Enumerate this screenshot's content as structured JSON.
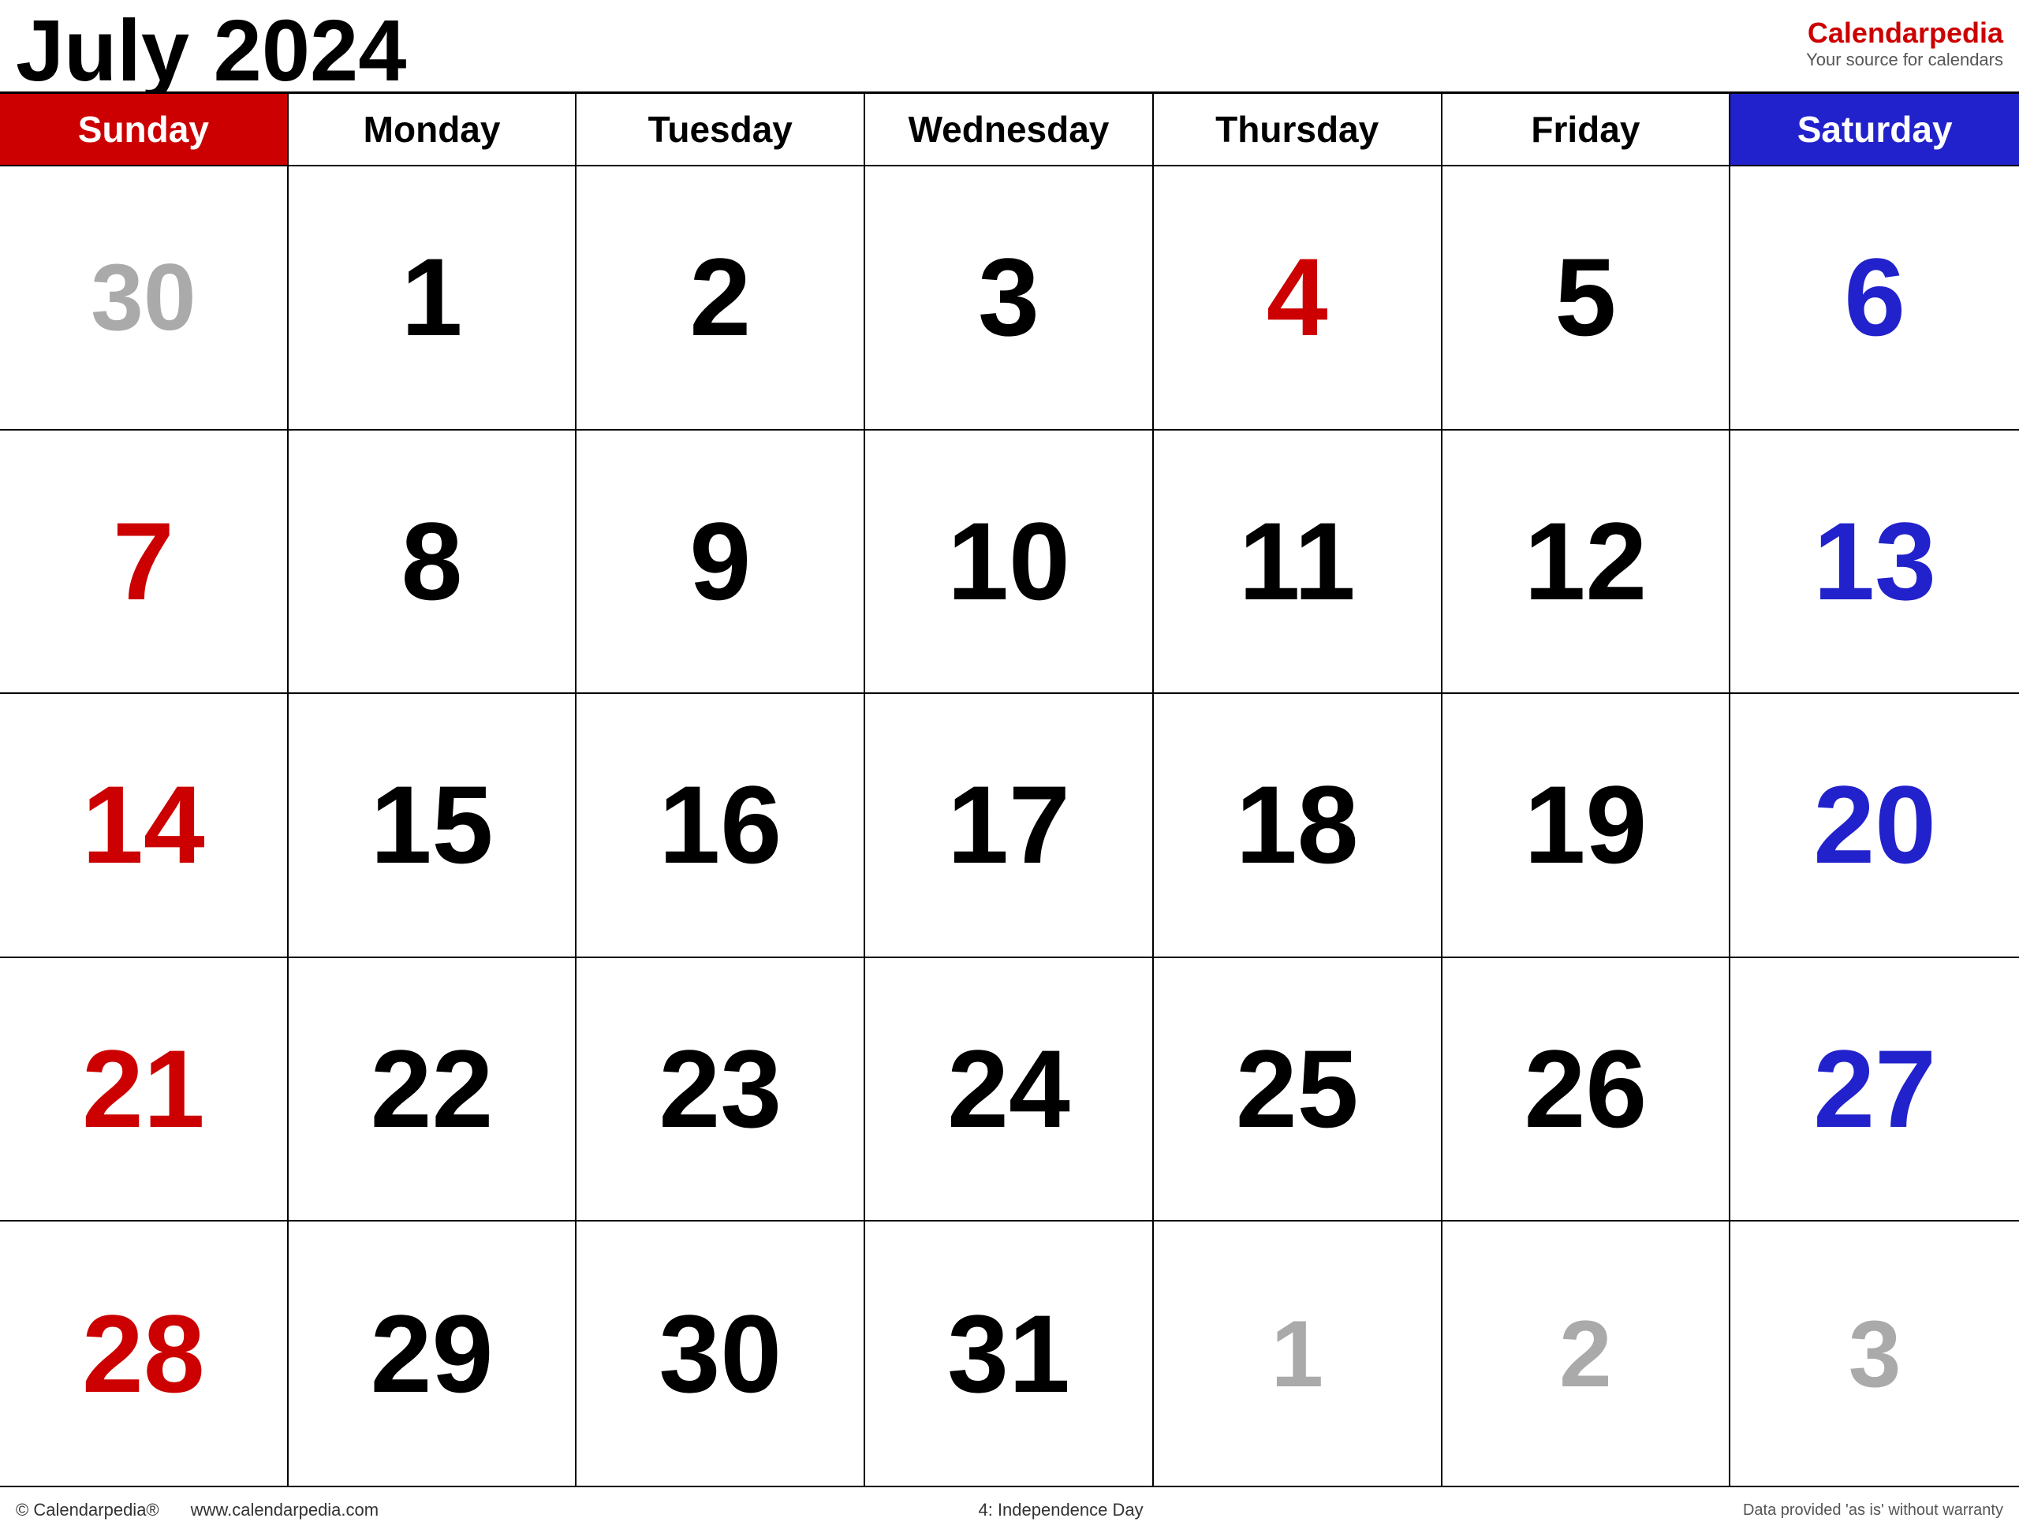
{
  "header": {
    "title": "July 2024",
    "brand": {
      "name": "Calendar",
      "name_accent": "pedia",
      "tagline": "Your source for calendars"
    }
  },
  "colors": {
    "sunday": "#cc0000",
    "saturday": "#2222cc",
    "holiday": "#cc0000",
    "other_month": "#aaaaaa",
    "header_sunday_bg": "#cc0000",
    "header_saturday_bg": "#2222cc"
  },
  "days_of_week": [
    {
      "label": "Sunday",
      "type": "sunday"
    },
    {
      "label": "Monday",
      "type": "weekday"
    },
    {
      "label": "Tuesday",
      "type": "weekday"
    },
    {
      "label": "Wednesday",
      "type": "weekday"
    },
    {
      "label": "Thursday",
      "type": "weekday"
    },
    {
      "label": "Friday",
      "type": "weekday"
    },
    {
      "label": "Saturday",
      "type": "saturday"
    }
  ],
  "weeks": [
    [
      {
        "day": "30",
        "type": "other-month"
      },
      {
        "day": "1",
        "type": "weekday"
      },
      {
        "day": "2",
        "type": "weekday"
      },
      {
        "day": "3",
        "type": "weekday"
      },
      {
        "day": "4",
        "type": "holiday"
      },
      {
        "day": "5",
        "type": "weekday"
      },
      {
        "day": "6",
        "type": "saturday"
      }
    ],
    [
      {
        "day": "7",
        "type": "sunday"
      },
      {
        "day": "8",
        "type": "weekday"
      },
      {
        "day": "9",
        "type": "weekday"
      },
      {
        "day": "10",
        "type": "weekday"
      },
      {
        "day": "11",
        "type": "weekday"
      },
      {
        "day": "12",
        "type": "weekday"
      },
      {
        "day": "13",
        "type": "saturday"
      }
    ],
    [
      {
        "day": "14",
        "type": "sunday"
      },
      {
        "day": "15",
        "type": "weekday"
      },
      {
        "day": "16",
        "type": "weekday"
      },
      {
        "day": "17",
        "type": "weekday"
      },
      {
        "day": "18",
        "type": "weekday"
      },
      {
        "day": "19",
        "type": "weekday"
      },
      {
        "day": "20",
        "type": "saturday"
      }
    ],
    [
      {
        "day": "21",
        "type": "sunday"
      },
      {
        "day": "22",
        "type": "weekday"
      },
      {
        "day": "23",
        "type": "weekday"
      },
      {
        "day": "24",
        "type": "weekday"
      },
      {
        "day": "25",
        "type": "weekday"
      },
      {
        "day": "26",
        "type": "weekday"
      },
      {
        "day": "27",
        "type": "saturday"
      }
    ],
    [
      {
        "day": "28",
        "type": "sunday"
      },
      {
        "day": "29",
        "type": "weekday"
      },
      {
        "day": "30",
        "type": "weekday"
      },
      {
        "day": "31",
        "type": "weekday"
      },
      {
        "day": "1",
        "type": "other-month"
      },
      {
        "day": "2",
        "type": "other-month"
      },
      {
        "day": "3",
        "type": "other-month"
      }
    ]
  ],
  "footer": {
    "copyright": "© Calendarpedia®",
    "website": "www.calendarpedia.com",
    "holiday_note": "4: Independence Day",
    "disclaimer": "Data provided 'as is' without warranty"
  }
}
